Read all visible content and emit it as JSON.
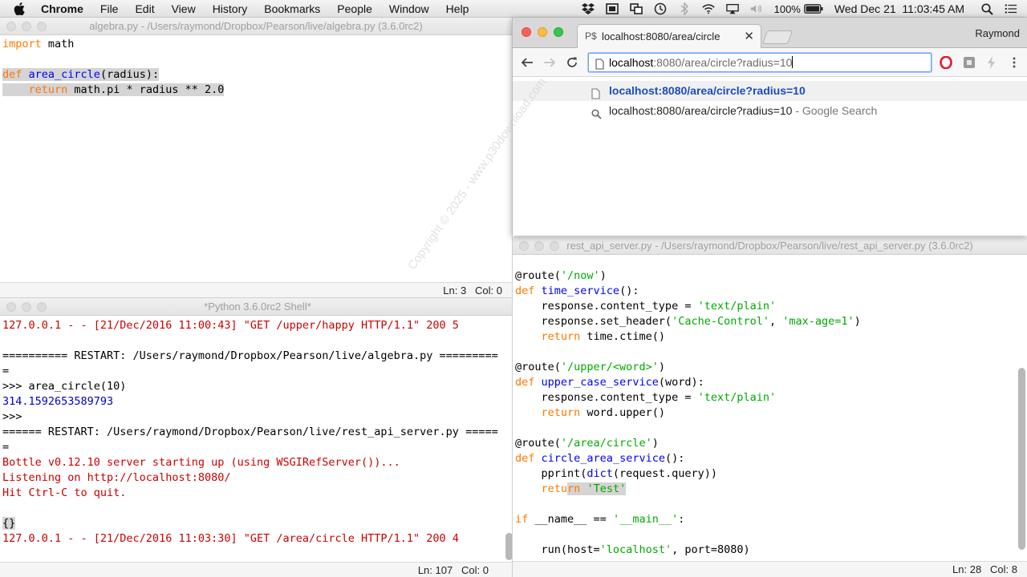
{
  "menubar": {
    "app_name": "Chrome",
    "items": [
      "File",
      "Edit",
      "View",
      "History",
      "Bookmarks",
      "People",
      "Window",
      "Help"
    ],
    "battery": "100%",
    "clock": "Wed Dec 21  11:03:45 AM"
  },
  "editor": {
    "title": "algebra.py - /Users/raymond/Dropbox/Pearson/live/algebra.py (3.6.0rc2)",
    "lines": [
      [
        {
          "t": "import",
          "c": "kw"
        },
        {
          "t": " math",
          "c": ""
        }
      ],
      [
        {
          "t": "",
          "c": ""
        }
      ],
      [
        {
          "t": "def",
          "c": "kw sel"
        },
        {
          "t": " ",
          "c": "sel"
        },
        {
          "t": "area_circle",
          "c": "def sel"
        },
        {
          "t": "(radius):",
          "c": "sel"
        }
      ],
      [
        {
          "t": "    ",
          "c": "sel"
        },
        {
          "t": "return",
          "c": "kw sel"
        },
        {
          "t": " math.pi * radius ** 2.0",
          "c": "sel"
        }
      ]
    ],
    "status": "Ln: 3   Col: 0"
  },
  "shell": {
    "title": "*Python 3.6.0rc2 Shell*",
    "lines": [
      [
        {
          "t": "127.0.0.1 - - [21/Dec/2016 11:00:43] \"GET /upper/happy HTTP/1.1\" 200 5",
          "c": "err"
        }
      ],
      [
        {
          "t": "",
          "c": ""
        }
      ],
      [
        {
          "t": "========== RESTART: /Users/raymond/Dropbox/Pearson/live/algebra.py =========",
          "c": ""
        }
      ],
      [
        {
          "t": "=",
          "c": ""
        }
      ],
      [
        {
          "t": ">>> area_circle(10)",
          "c": ""
        }
      ],
      [
        {
          "t": "314.1592653589793",
          "c": "out"
        }
      ],
      [
        {
          "t": ">>> ",
          "c": ""
        }
      ],
      [
        {
          "t": "====== RESTART: /Users/raymond/Dropbox/Pearson/live/rest_api_server.py =====",
          "c": ""
        }
      ],
      [
        {
          "t": "=",
          "c": ""
        }
      ],
      [
        {
          "t": "Bottle v0.12.10 server starting up (using WSGIRefServer())...",
          "c": "err"
        }
      ],
      [
        {
          "t": "Listening on http://localhost:8080/",
          "c": "err"
        }
      ],
      [
        {
          "t": "Hit Ctrl-C to quit.",
          "c": "err"
        }
      ],
      [
        {
          "t": "",
          "c": ""
        }
      ],
      [
        {
          "t": "{}",
          "c": "sel"
        }
      ],
      [
        {
          "t": "127.0.0.1 - - [21/Dec/2016 11:03:30] \"GET /area/circle HTTP/1.1\" 200 4",
          "c": "err"
        }
      ]
    ],
    "status": "Ln: 107   Col: 0"
  },
  "server": {
    "title": "rest_api_server.py - /Users/raymond/Dropbox/Pearson/live/rest_api_server.py (3.6.0rc2)",
    "lines": [
      [
        {
          "t": "@route(",
          "c": ""
        },
        {
          "t": "'/now'",
          "c": "str"
        },
        {
          "t": ")",
          "c": ""
        }
      ],
      [
        {
          "t": "def",
          "c": "kw"
        },
        {
          "t": " ",
          "c": ""
        },
        {
          "t": "time_service",
          "c": "def"
        },
        {
          "t": "():",
          "c": ""
        }
      ],
      [
        {
          "t": "    response.content_type = ",
          "c": ""
        },
        {
          "t": "'text/plain'",
          "c": "str"
        }
      ],
      [
        {
          "t": "    response.set_header(",
          "c": ""
        },
        {
          "t": "'Cache-Control'",
          "c": "str"
        },
        {
          "t": ", ",
          "c": ""
        },
        {
          "t": "'max-age=1'",
          "c": "str"
        },
        {
          "t": ")",
          "c": ""
        }
      ],
      [
        {
          "t": "    ",
          "c": ""
        },
        {
          "t": "return",
          "c": "kw"
        },
        {
          "t": " time.ctime()",
          "c": ""
        }
      ],
      [
        {
          "t": "",
          "c": ""
        }
      ],
      [
        {
          "t": "@route(",
          "c": ""
        },
        {
          "t": "'/upper/<word>'",
          "c": "str"
        },
        {
          "t": ")",
          "c": ""
        }
      ],
      [
        {
          "t": "def",
          "c": "kw"
        },
        {
          "t": " ",
          "c": ""
        },
        {
          "t": "upper_case_service",
          "c": "def"
        },
        {
          "t": "(word):",
          "c": ""
        }
      ],
      [
        {
          "t": "    response.content_type = ",
          "c": ""
        },
        {
          "t": "'text/plain'",
          "c": "str"
        }
      ],
      [
        {
          "t": "    ",
          "c": ""
        },
        {
          "t": "return",
          "c": "kw"
        },
        {
          "t": " word.upper()",
          "c": ""
        }
      ],
      [
        {
          "t": "",
          "c": ""
        }
      ],
      [
        {
          "t": "@route(",
          "c": ""
        },
        {
          "t": "'/area/circle'",
          "c": "str"
        },
        {
          "t": ")",
          "c": ""
        }
      ],
      [
        {
          "t": "def",
          "c": "kw"
        },
        {
          "t": " ",
          "c": ""
        },
        {
          "t": "circle_area_service",
          "c": "def"
        },
        {
          "t": "():",
          "c": ""
        }
      ],
      [
        {
          "t": "    pprint(",
          "c": ""
        },
        {
          "t": "dict",
          "c": "out"
        },
        {
          "t": "(request.query))",
          "c": ""
        }
      ],
      [
        {
          "t": "    ",
          "c": ""
        },
        {
          "t": "retu",
          "c": "kw"
        },
        {
          "t": "rn",
          "c": "kw sel"
        },
        {
          "t": " ",
          "c": "sel"
        },
        {
          "t": "'Test'",
          "c": "str sel"
        }
      ],
      [
        {
          "t": "",
          "c": ""
        }
      ],
      [
        {
          "t": "if",
          "c": "kw"
        },
        {
          "t": " __name__ == ",
          "c": ""
        },
        {
          "t": "'__main__'",
          "c": "str"
        },
        {
          "t": ":",
          "c": ""
        }
      ],
      [
        {
          "t": "",
          "c": ""
        }
      ],
      [
        {
          "t": "    run(host=",
          "c": ""
        },
        {
          "t": "'localhost'",
          "c": "str"
        },
        {
          "t": ", port=8080)",
          "c": ""
        }
      ]
    ],
    "status": "Ln: 28   Col: 8"
  },
  "browser": {
    "tab_title": "localhost:8080/area/circle",
    "tab_icon_text": "P$",
    "profile": "Raymond",
    "address_host": "localhost",
    "address_path": ":8080/area/circle?radius=10",
    "suggestion_url": "localhost:8080/area/circle?radius=10",
    "suggestion_search_query": "localhost:8080/area/circle?radius=10",
    "suggestion_search_engine": " - Google Search"
  },
  "watermark": "Copyright © 2025 - www.p30download.com"
}
